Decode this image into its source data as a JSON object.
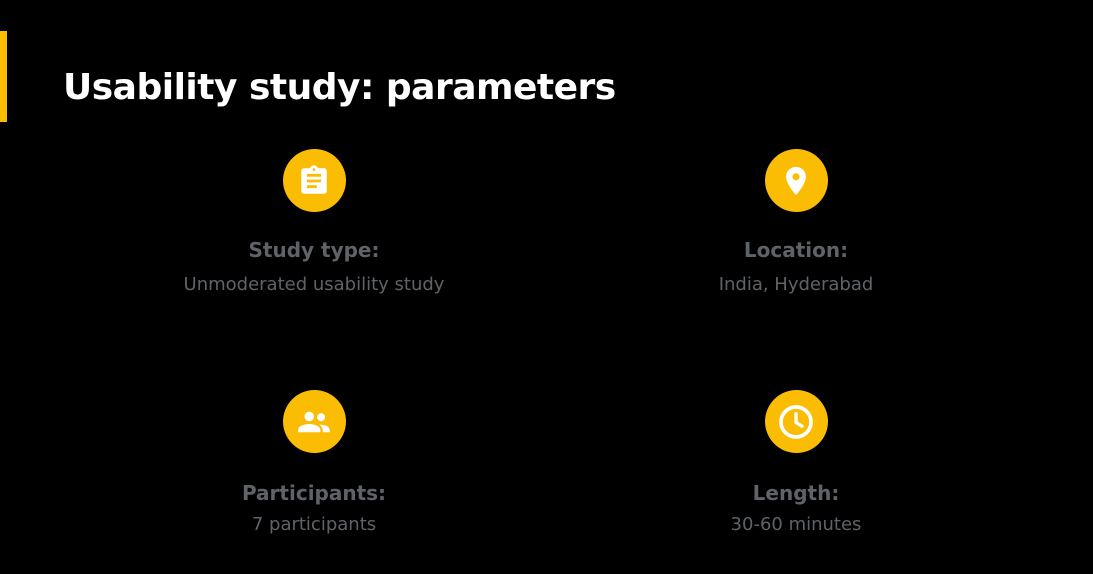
{
  "title": "Usability study: parameters",
  "colors": {
    "accent": "#FBBC04",
    "background": "#000000",
    "title_text": "#ffffff",
    "muted_text": "#5f6368"
  },
  "parameters": [
    {
      "icon": "clipboard-icon",
      "label": "Study type:",
      "value": "Unmoderated usability study"
    },
    {
      "icon": "location-pin-icon",
      "label": "Location:",
      "value": "India, Hyderabad"
    },
    {
      "icon": "people-icon",
      "label": "Participants:",
      "value": "7 participants"
    },
    {
      "icon": "clock-icon",
      "label": "Length:",
      "value": "30-60 minutes"
    }
  ]
}
